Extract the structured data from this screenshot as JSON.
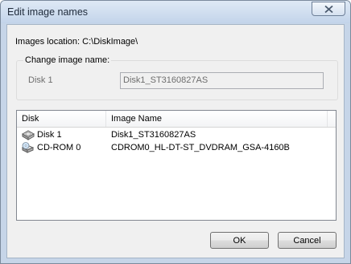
{
  "window": {
    "title": "Edit image names"
  },
  "images_location": {
    "label": "Images location: C:\\DiskImage\\"
  },
  "change_group": {
    "legend": "Change image name:",
    "field_label": "Disk 1",
    "field_value": "Disk1_ST3160827AS"
  },
  "list": {
    "columns": [
      "Disk",
      "Image Name"
    ],
    "rows": [
      {
        "disk": "Disk 1",
        "image_name": "Disk1_ST3160827AS",
        "icon": "hard-disk-icon"
      },
      {
        "disk": "CD-ROM 0",
        "image_name": "CDROM0_HL-DT-ST_DVDRAM_GSA-4160B",
        "icon": "cd-rom-icon"
      }
    ]
  },
  "buttons": {
    "ok": "OK",
    "cancel": "Cancel"
  }
}
